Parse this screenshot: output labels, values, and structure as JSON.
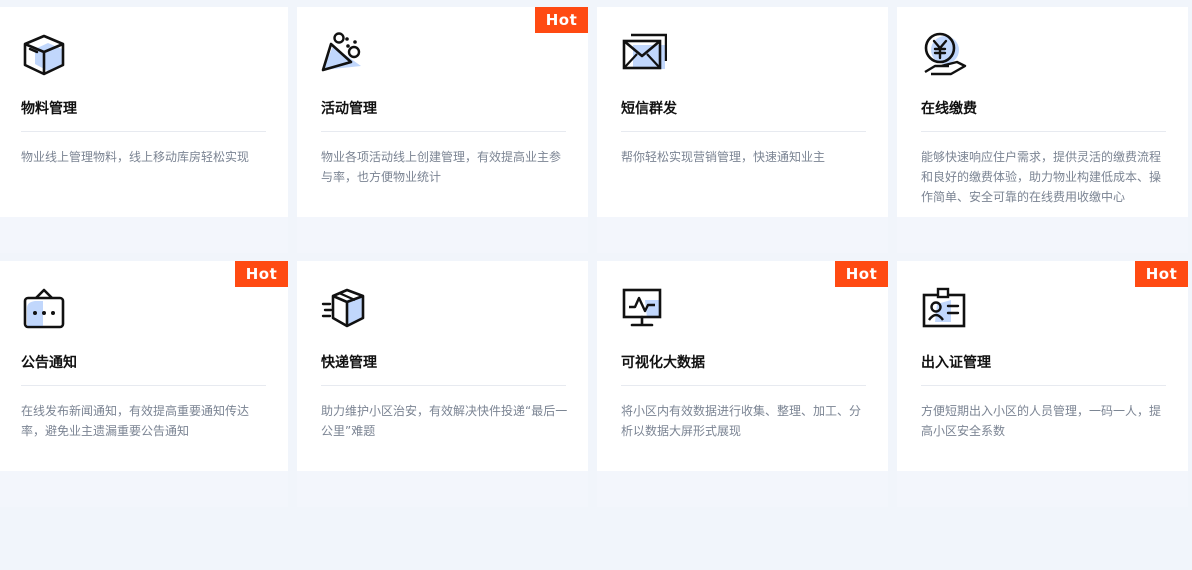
{
  "colors": {
    "accent": "#ff4a12",
    "icon_fill": "#4d8cf5",
    "page_bg": "#f1f5fb"
  },
  "cards": [
    {
      "title": "物料管理",
      "desc": "物业线上管理物料，线上移动库房轻松实现",
      "hot": "",
      "icon": "box-icon"
    },
    {
      "title": "活动管理",
      "desc": "物业各项活动线上创建管理，有效提高业主参与率，也方便物业统计",
      "hot": "Hot",
      "icon": "party-popper-icon"
    },
    {
      "title": "短信群发",
      "desc": "帮你轻松实现营销管理，快速通知业主",
      "hot": "",
      "icon": "envelope-icon"
    },
    {
      "title": "在线缴费",
      "desc": "能够快速响应住户需求，提供灵活的缴费流程和良好的缴费体验，助力物业构建低成本、操作简单、安全可靠的在线费用收缴中心",
      "hot": "",
      "icon": "yen-payment-icon"
    },
    {
      "title": "公告通知",
      "desc": "在线发布新闻通知，有效提高重要通知传达率，避免业主遗漏重要公告通知",
      "hot": "Hot",
      "icon": "notice-board-icon"
    },
    {
      "title": "快递管理",
      "desc": "助力维护小区治安，有效解决快件投递“最后一公里”难题",
      "hot": "",
      "icon": "delivery-box-icon"
    },
    {
      "title": "可视化大数据",
      "desc": "将小区内有效数据进行收集、整理、加工、分析以数据大屏形式展现",
      "hot": "Hot",
      "icon": "monitor-chart-icon"
    },
    {
      "title": "出入证管理",
      "desc": "方便短期出入小区的人员管理，一码一人，提高小区安全系数",
      "hot": "Hot",
      "icon": "id-badge-icon"
    }
  ]
}
